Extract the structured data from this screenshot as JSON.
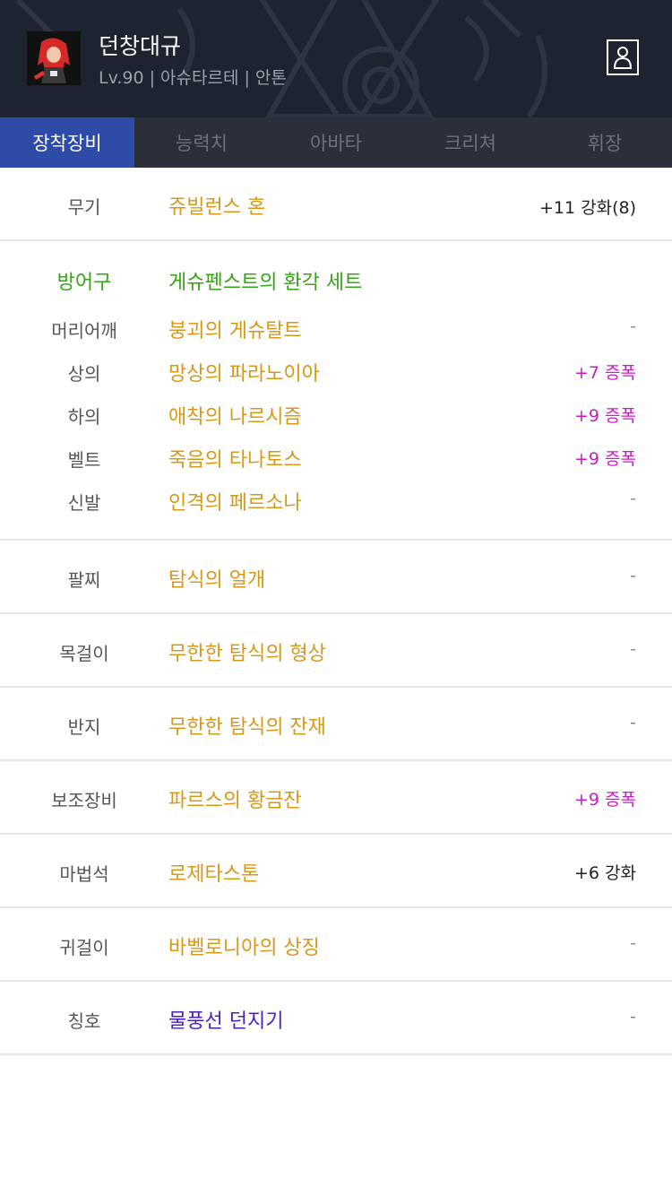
{
  "character": {
    "name": "던창대규",
    "info": "Lv.90 | 아슈타르테 | 안톤"
  },
  "tabs": [
    {
      "label": "장착장비",
      "active": true
    },
    {
      "label": "능력치",
      "active": false
    },
    {
      "label": "아바타",
      "active": false
    },
    {
      "label": "크리쳐",
      "active": false
    },
    {
      "label": "휘장",
      "active": false
    }
  ],
  "equipment": {
    "weapon": {
      "slot": "무기",
      "item": "쥬빌런스 혼",
      "stat": "+11 강화(8)"
    },
    "armor": {
      "slot": "방어구",
      "set_name": "게슈펜스트의 환각 세트",
      "pieces": [
        {
          "slot": "머리어깨",
          "item": "붕괴의 게슈탈트",
          "stat": "-"
        },
        {
          "slot": "상의",
          "item": "망상의 파라노이아",
          "stat": "+7 증폭"
        },
        {
          "slot": "하의",
          "item": "애착의 나르시즘",
          "stat": "+9 증폭"
        },
        {
          "slot": "벨트",
          "item": "죽음의 타나토스",
          "stat": "+9 증폭"
        },
        {
          "slot": "신발",
          "item": "인격의 페르소나",
          "stat": "-"
        }
      ]
    },
    "bracelet": {
      "slot": "팔찌",
      "item": "탐식의 얼개",
      "stat": "-"
    },
    "necklace": {
      "slot": "목걸이",
      "item": "무한한 탐식의 형상",
      "stat": "-"
    },
    "ring": {
      "slot": "반지",
      "item": "무한한 탐식의 잔재",
      "stat": "-"
    },
    "subequip": {
      "slot": "보조장비",
      "item": "파르스의 황금잔",
      "stat": "+9 증폭"
    },
    "magicstone": {
      "slot": "마법석",
      "item": "로제타스톤",
      "stat": "+6 강화"
    },
    "earring": {
      "slot": "귀걸이",
      "item": "바벨로니아의 상징",
      "stat": "-"
    },
    "title": {
      "slot": "칭호",
      "item": "물풍선 던지기",
      "stat": "-"
    }
  },
  "colors": {
    "header_bg": "#1e2330",
    "tab_bar_bg": "#2b2f3a",
    "tab_active_bg": "#2e4ba8",
    "unique_item": "#d79817",
    "set_item": "#35a418",
    "rare_item": "#4a1fb8",
    "amplify": "#c61cc6"
  },
  "icons": {
    "profile": "person-outline-icon",
    "avatar": "character-portrait"
  }
}
